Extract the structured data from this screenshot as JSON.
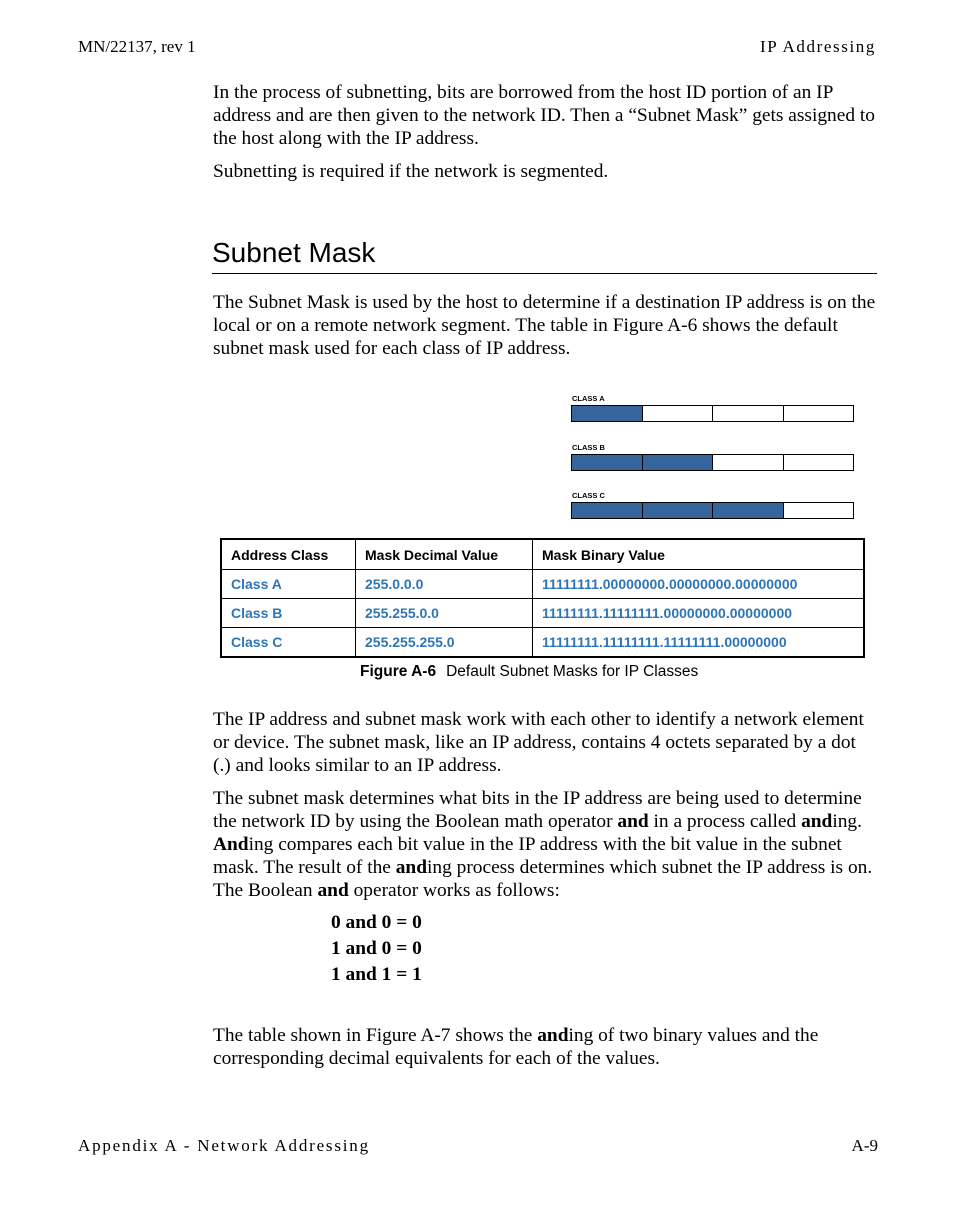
{
  "header": {
    "doc_id": "MN/22137, rev 1",
    "section": "IP Addressing"
  },
  "footer": {
    "appendix": "Appendix A - Network Addressing",
    "page": "A-9"
  },
  "intro": {
    "p1": "In the process of subnetting, bits are borrowed from the host ID portion of an IP address and are then given to the network ID. Then a “Subnet Mask” gets assigned to the host along with the IP address.",
    "p2": "Subnetting is required if the network is segmented."
  },
  "section": {
    "title": "Subnet Mask",
    "p1": "The Subnet Mask is used by the host to determine if a destination IP address is on the local or on a remote network segment. The table in Figure A-6 shows the default subnet mask used for each class of IP address."
  },
  "figure": {
    "bars": [
      {
        "label": "CLASS A",
        "filled_octets": 1,
        "total_octets": 4
      },
      {
        "label": "CLASS B",
        "filled_octets": 2,
        "total_octets": 4
      },
      {
        "label": "CLASS C",
        "filled_octets": 3,
        "total_octets": 4
      }
    ],
    "fill_color": "#34659b",
    "table": {
      "headers": [
        "Address Class",
        "Mask Decimal Value",
        "Mask Binary Value"
      ],
      "rows": [
        [
          "Class A",
          "255.0.0.0",
          "11111111.00000000.00000000.00000000"
        ],
        [
          "Class B",
          "255.255.0.0",
          "11111111.11111111.00000000.00000000"
        ],
        [
          "Class C",
          "255.255.255.0",
          "11111111.11111111.11111111.00000000"
        ]
      ],
      "value_color": "#2e75b6"
    },
    "caption_label": "Figure A-6",
    "caption_text": "Default Subnet Masks for IP Classes"
  },
  "body": {
    "p1": "The IP address and subnet mask work with each other to identify a network element or device. The subnet mask, like an IP address, contains 4 octets separated by a dot (.) and looks similar to an IP address.",
    "p2_parts": {
      "a": "The subnet mask determines what bits in the IP address are being used to determine the network ID by using the Boolean math operator ",
      "b": "and",
      "c": " in a process called ",
      "d": "and",
      "e": "ing. ",
      "f": "And",
      "g": "ing compares each bit value in the IP address with the bit value in the subnet mask. The result of the ",
      "h": "and",
      "i": "ing process determines which subnet the IP address is on. The Boolean ",
      "j": "and",
      "k": " operator works as follows:"
    },
    "and_rules": [
      "0 and 0 = 0",
      "1 and 0 = 0",
      "1 and 1 = 1"
    ],
    "p3_parts": {
      "a": "The table shown in Figure A-7 shows the ",
      "b": "and",
      "c": "ing of two binary values and the corresponding decimal equivalents for each of the values."
    }
  }
}
